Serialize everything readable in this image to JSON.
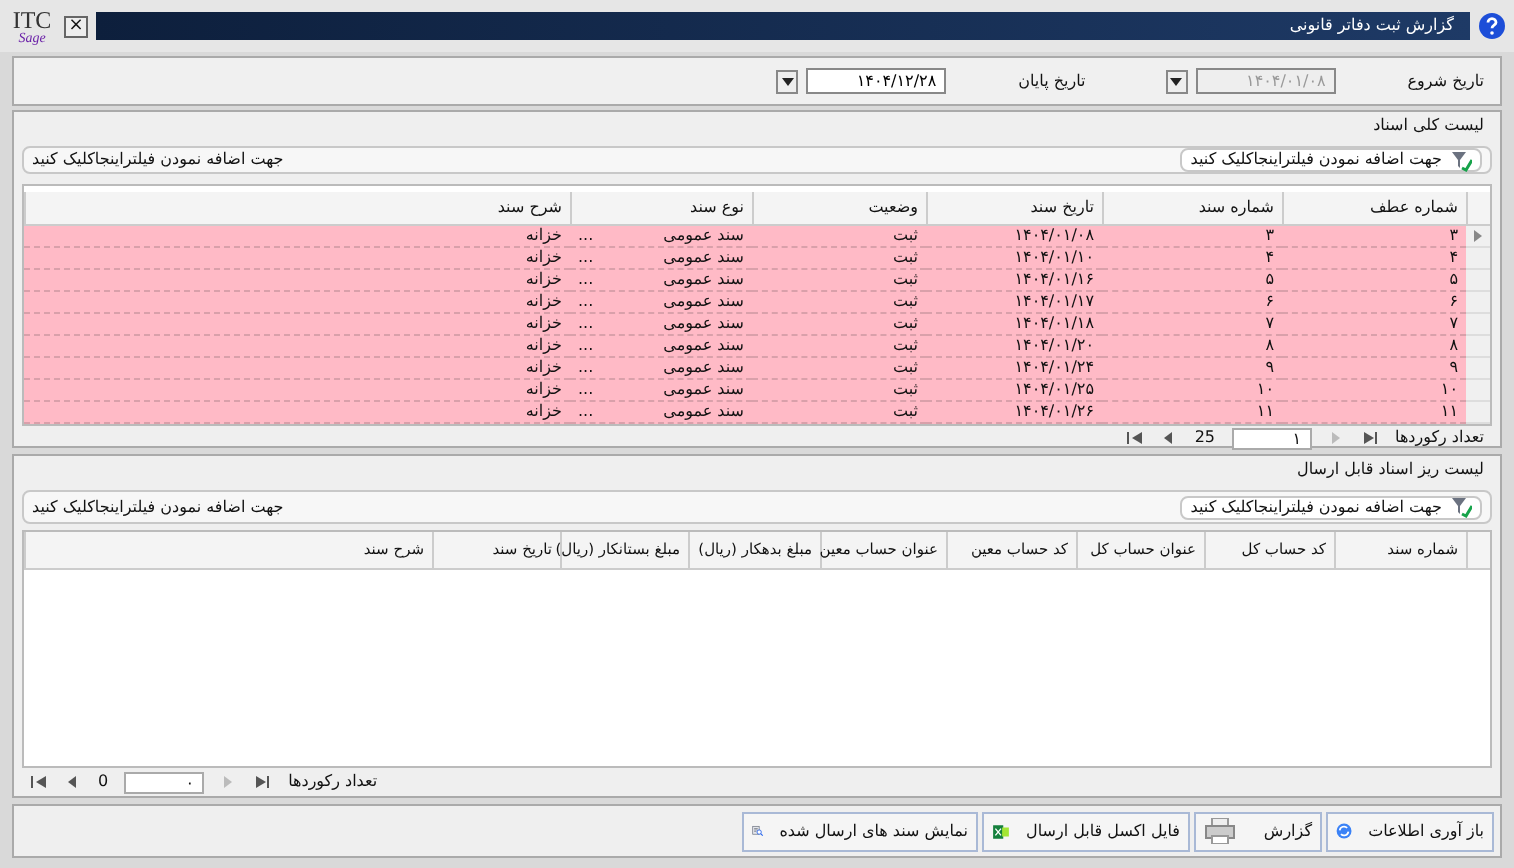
{
  "window": {
    "title": "گزارش ثبت دفاتر قانونی",
    "logo": "ITC",
    "logo_sub": "Sage",
    "close": "×"
  },
  "dates": [
    {
      "label": "تاریخ شروع",
      "value": "۱۴۰۴/۰۱/۰۸",
      "disabled": true
    },
    {
      "label": "تاریخ پایان",
      "value": "۱۴۰۴/۱۲/۲۸",
      "disabled": false
    }
  ],
  "documents": {
    "title": "لیست کلی اسناد",
    "filter_button": "جهت اضافه نمودن فیلتراینجاکلیک کنید",
    "filter_text": "جهت اضافه نمودن فیلتراینجاکلیک کنید",
    "columns": [
      "شماره عطف",
      "شماره سند",
      "تاریخ سند",
      "وضعیت",
      "نوع سند",
      "شرح سند"
    ],
    "rows": [
      {
        "ref": "۳",
        "number": "۳",
        "date": "۱۴۰۴/۰۱/۰۸",
        "status": "ثبت",
        "type": "سند عمومی",
        "more": "...",
        "description": "خزانه",
        "selected": true
      },
      {
        "ref": "۴",
        "number": "۴",
        "date": "۱۴۰۴/۰۱/۱۰",
        "status": "ثبت",
        "type": "سند عمومی",
        "more": "...",
        "description": "خزانه",
        "selected": false
      },
      {
        "ref": "۵",
        "number": "۵",
        "date": "۱۴۰۴/۰۱/۱۶",
        "status": "ثبت",
        "type": "سند عمومی",
        "more": "...",
        "description": "خزانه",
        "selected": false
      },
      {
        "ref": "۶",
        "number": "۶",
        "date": "۱۴۰۴/۰۱/۱۷",
        "status": "ثبت",
        "type": "سند عمومی",
        "more": "...",
        "description": "خزانه",
        "selected": false
      },
      {
        "ref": "۷",
        "number": "۷",
        "date": "۱۴۰۴/۰۱/۱۸",
        "status": "ثبت",
        "type": "سند عمومی",
        "more": "...",
        "description": "خزانه",
        "selected": false
      },
      {
        "ref": "۸",
        "number": "۸",
        "date": "۱۴۰۴/۰۱/۲۰",
        "status": "ثبت",
        "type": "سند عمومی",
        "more": "...",
        "description": "خزانه",
        "selected": false
      },
      {
        "ref": "۹",
        "number": "۹",
        "date": "۱۴۰۴/۰۱/۲۴",
        "status": "ثبت",
        "type": "سند عمومی",
        "more": "...",
        "description": "خزانه",
        "selected": false
      },
      {
        "ref": "۱۰",
        "number": "۱۰",
        "date": "۱۴۰۴/۰۱/۲۵",
        "status": "ثبت",
        "type": "سند عمومی",
        "more": "...",
        "description": "خزانه",
        "selected": false
      },
      {
        "ref": "۱۱",
        "number": "۱۱",
        "date": "۱۴۰۴/۰۱/۲۶",
        "status": "ثبت",
        "type": "سند عمومی",
        "more": "...",
        "description": "خزانه",
        "selected": false
      }
    ],
    "pager": {
      "label": "تعداد رکوردها",
      "page_size": "25",
      "page": "۱"
    }
  },
  "sendable": {
    "title": "لیست ریز اسناد قابل ارسال",
    "filter_button": "جهت اضافه نمودن فیلتراینجاکلیک کنید",
    "filter_text": "جهت اضافه نمودن فیلتراینجاکلیک کنید",
    "columns": [
      "شماره سند",
      "کد حساب کل",
      "عنوان حساب کل",
      "کد حساب معین",
      "عنوان حساب معین",
      "مبلغ بدهکار (ریال)",
      "مبلغ بستانکار (ریال)",
      "تاریخ سند",
      "شرح سند"
    ],
    "pager": {
      "label": "تعداد رکوردها",
      "page_size": "0",
      "page": "۰"
    }
  },
  "buttons": [
    {
      "label": "باز آوری اطلاعات",
      "kind": "refresh"
    },
    {
      "label": "گزارش",
      "kind": "print"
    },
    {
      "label": "فایل اکسل قابل ارسال",
      "kind": "excel"
    },
    {
      "label": "نمایش سند های ارسال شده",
      "kind": "view"
    }
  ]
}
